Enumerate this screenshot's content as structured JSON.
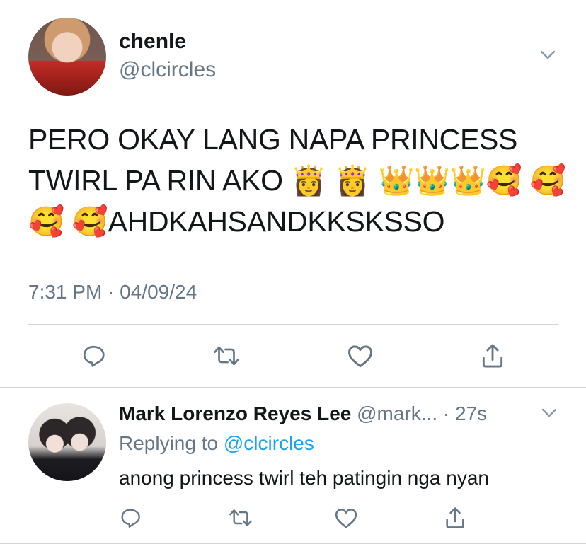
{
  "tweet": {
    "display_name": "chenle",
    "handle": "@clcircles",
    "text": "PERO OKAY LANG NAPA PRINCESS TWIRL PA RIN AKO 👸 👸 👑👑👑🥰 🥰 🥰 🥰AHDKAHSANDKKSKSSO",
    "timestamp": "7:31 PM · 04/09/24",
    "actions": [
      "reply-icon",
      "retweet-icon",
      "like-icon",
      "share-icon"
    ]
  },
  "reply": {
    "display_name": "Mark Lorenzo Reyes Lee",
    "handle": "@mark...",
    "time": "· 27s",
    "replying_prefix": "Replying to",
    "replying_target": "@clcircles",
    "text": "anong princess twirl teh patingin nga nyan",
    "actions": [
      "reply-icon",
      "retweet-icon",
      "like-icon",
      "share-icon"
    ]
  },
  "colors": {
    "primary_text": "#14171a",
    "secondary_text": "#657786",
    "link_blue": "#1da1f2",
    "divider": "#cfd4d8"
  }
}
